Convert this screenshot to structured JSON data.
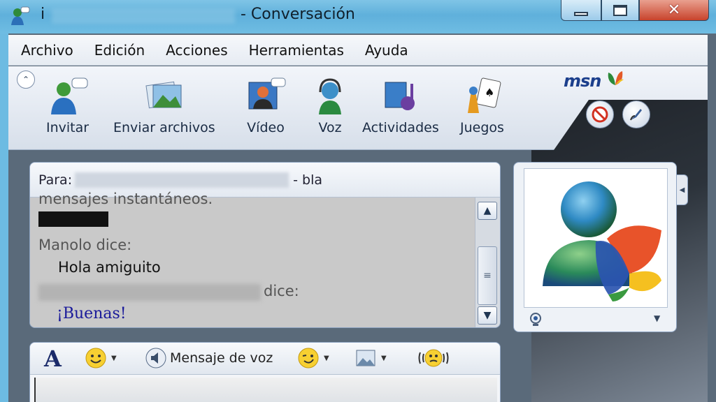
{
  "window": {
    "title_prefix": "i",
    "title_suffix": "- Conversación",
    "controls": {
      "minimize": "minimize",
      "maximize": "maximize",
      "close": "✕"
    }
  },
  "menu": [
    "Archivo",
    "Edición",
    "Acciones",
    "Herramientas",
    "Ayuda"
  ],
  "toolbar": {
    "items": [
      {
        "label": "Invitar",
        "icon": "invite-contact-icon"
      },
      {
        "label": "Enviar archivos",
        "icon": "send-files-icon"
      },
      {
        "label": "Vídeo",
        "icon": "video-icon"
      },
      {
        "label": "Voz",
        "icon": "voice-headset-icon"
      },
      {
        "label": "Actividades",
        "icon": "activities-icon"
      },
      {
        "label": "Juegos",
        "icon": "games-icon"
      }
    ],
    "brand": "msn",
    "right_buttons": [
      "block-icon",
      "background-icon"
    ]
  },
  "conversation": {
    "to_label": "Para:",
    "to_suffix": "- bla",
    "clipped_line": "mensajes instantáneos.",
    "messages": [
      {
        "sender": "Manolo dice:",
        "text": "Hola amiguito"
      },
      {
        "sender": "dice:",
        "text": "¡Buenas!"
      }
    ]
  },
  "compose": {
    "voice_clip_label": "Mensaje de voz"
  },
  "colors": {
    "titlebar": "#6fbde3",
    "msg_blue": "#1a1a9a",
    "msn_blue": "#1c3f8c"
  }
}
